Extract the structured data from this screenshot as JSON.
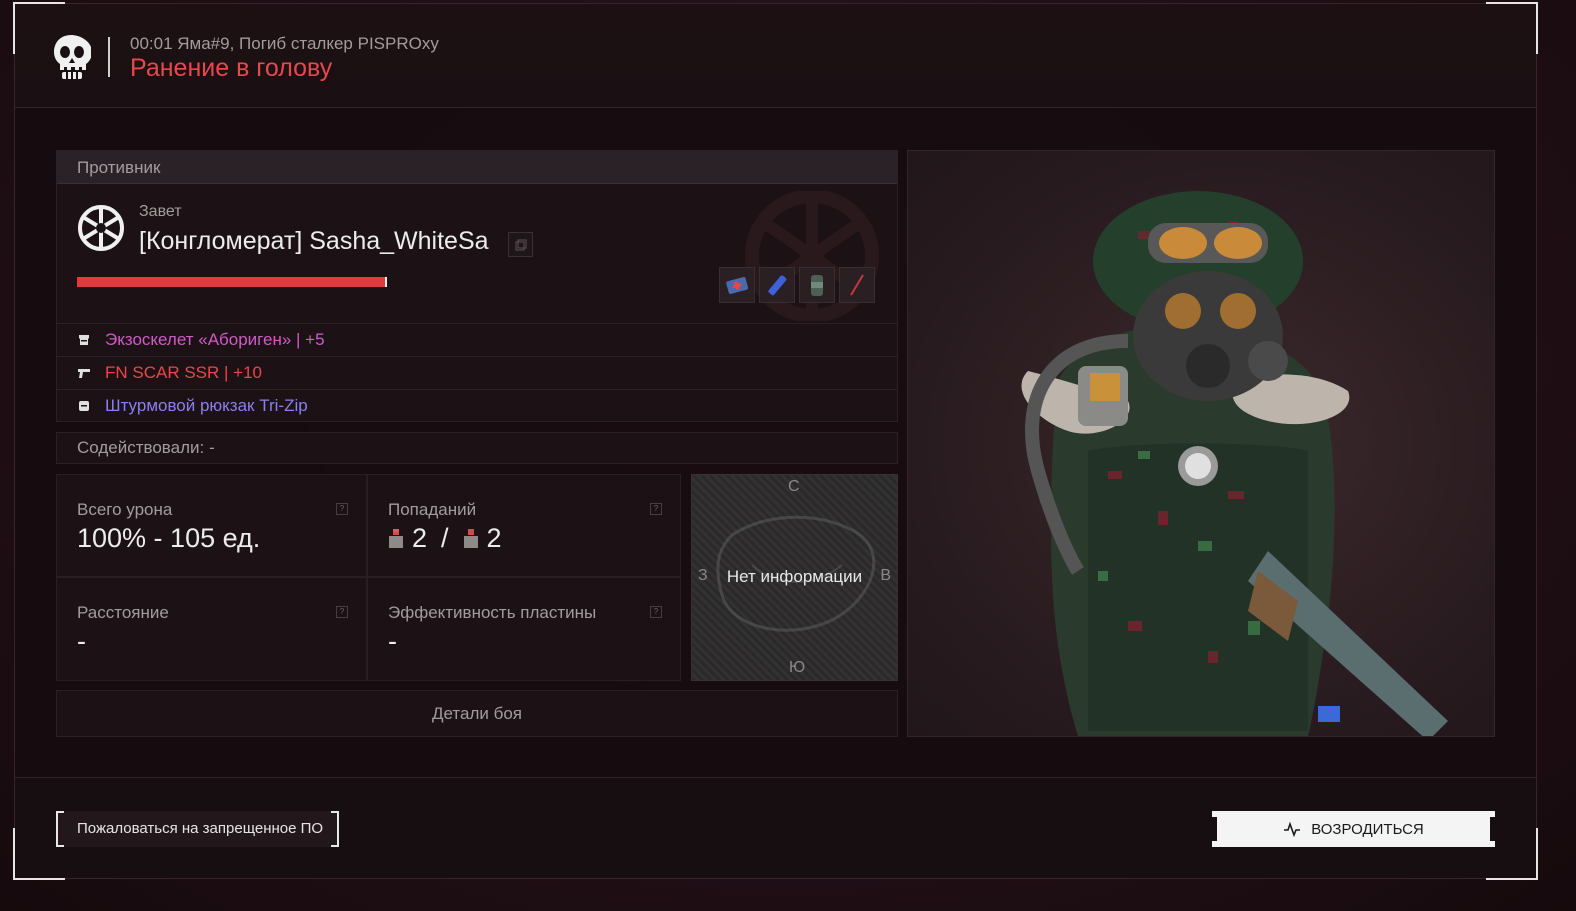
{
  "header": {
    "subtitle": "00:01 Яма#9, Погиб сталкер PISPROxy",
    "title": "Ранение в голову"
  },
  "enemy": {
    "section_label": "Противник",
    "faction": "Завет",
    "name": "[Конгломерат] Sasha_WhiteSa",
    "health_fraction": 1.0,
    "consumables": [
      "medkit-icon",
      "stimulant-icon",
      "canister-icon",
      "empty-slot-icon"
    ],
    "equipment": [
      {
        "icon": "armor-icon",
        "label": "Экзоскелет «Абориген» | +5",
        "color": "#d05ac8"
      },
      {
        "icon": "gun-icon",
        "label": "FN SCAR SSR | +10",
        "color": "#e5484d"
      },
      {
        "icon": "backpack-icon",
        "label": "Штурмовой рюкзак Tri-Zip",
        "color": "#8c7ef0"
      }
    ]
  },
  "assist": {
    "text": "Содействовали:  -"
  },
  "stats": {
    "damage_label": "Всего урона",
    "damage_value": "100% - 105 ед.",
    "hits_label": "Попаданий",
    "hits_a": "2",
    "hits_sep": "/",
    "hits_b": "2",
    "distance_label": "Расстояние",
    "distance_value": "-",
    "plate_label": "Эффективность пластины",
    "plate_value": "-",
    "help": "?"
  },
  "minimap": {
    "north": "С",
    "south": "Ю",
    "west": "З",
    "east": "В",
    "no_info": "Нет информации"
  },
  "details_button": "Детали боя",
  "footer": {
    "report_label": "Пожаловаться на запрещенное ПО",
    "respawn_label": "ВОЗРОДИТЬСЯ"
  },
  "colors": {
    "accent_red": "#e5484d",
    "health": "#e03a3e"
  }
}
